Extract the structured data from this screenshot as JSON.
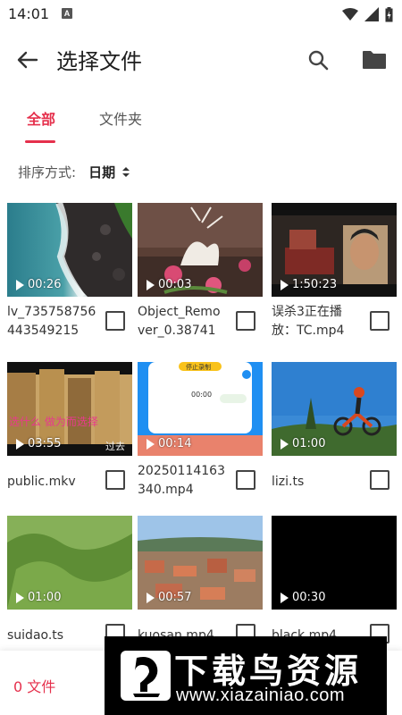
{
  "status_bar": {
    "time": "14:01",
    "notification": "A"
  },
  "header": {
    "title": "选择文件",
    "back_icon": "arrow-left-icon",
    "search_icon": "search-icon",
    "folder_icon": "folder-icon"
  },
  "tabs": [
    {
      "label": "全部",
      "active": true
    },
    {
      "label": "文件夹",
      "active": false
    }
  ],
  "sort": {
    "label": "排序方式:",
    "value": "日期"
  },
  "files": [
    {
      "name": "lv_735758756443549215",
      "duration": "00:26"
    },
    {
      "name": "Object_Remover_0.38741",
      "duration": "00:03"
    },
    {
      "name": "误杀3正在播放：TC.mp4",
      "duration": "1:50:23"
    },
    {
      "name": "public.mkv",
      "duration": "03:55"
    },
    {
      "name": "20250114163340.mp4",
      "duration": "00:14"
    },
    {
      "name": "lizi.ts",
      "duration": "01:00"
    },
    {
      "name": "suidao.ts",
      "duration": "01:00"
    },
    {
      "name": "kuosan.mp4",
      "duration": "00:57"
    },
    {
      "name": "black.mp4",
      "duration": "00:30"
    }
  ],
  "thumb_texts": {
    "public_overlay": "选什么  做为而选择",
    "public_corner": "过去",
    "app_button": "停止录制",
    "app_timer": "00:00"
  },
  "bottom": {
    "count_label": "0 文件"
  },
  "watermark": {
    "title": "下载鸟资源",
    "url": "www.xiazainiao.com"
  },
  "colors": {
    "accent": "#e5304c",
    "text": "#222222",
    "muted": "#555555"
  }
}
